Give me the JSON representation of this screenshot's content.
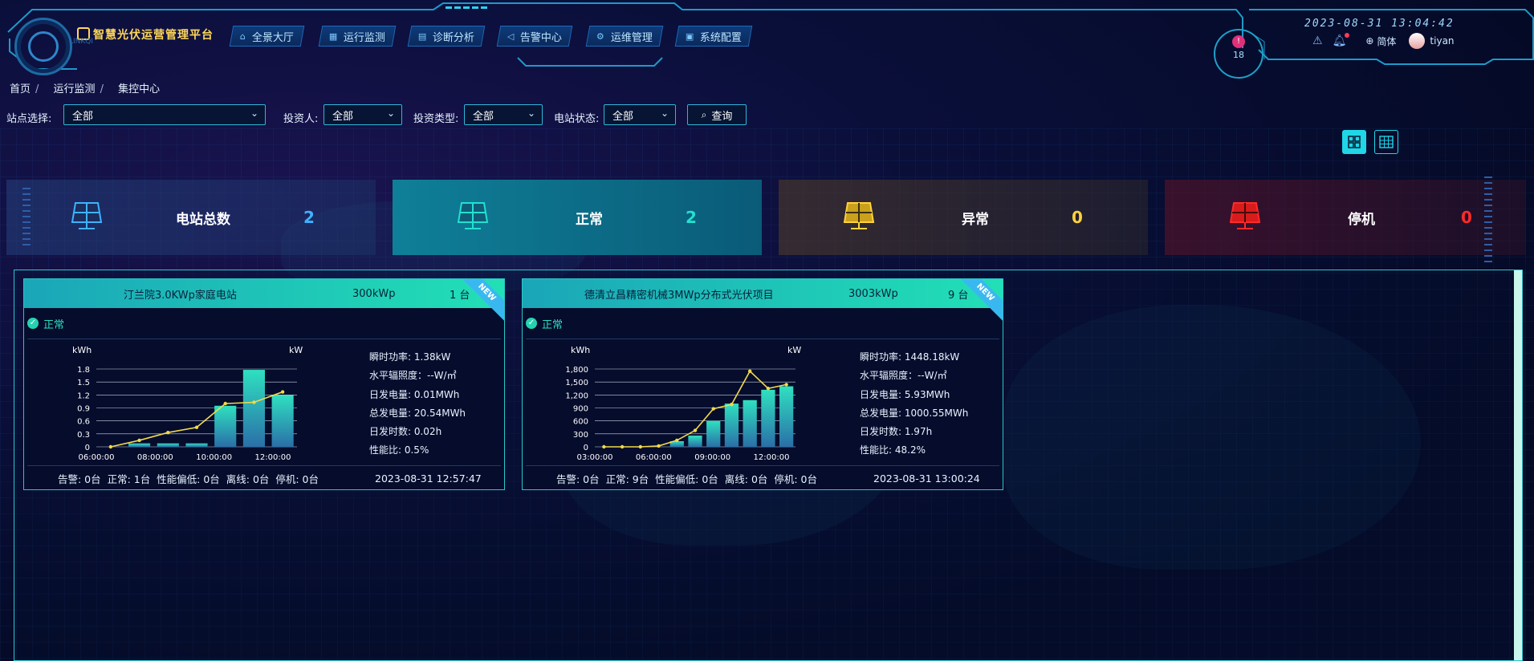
{
  "header": {
    "brand": "智慧光伏运营管理平台",
    "brand_sub": "LINKQI",
    "nav": [
      {
        "label": "全景大厅",
        "icon": "home-icon"
      },
      {
        "label": "运行监测",
        "icon": "grid-icon"
      },
      {
        "label": "诊断分析",
        "icon": "doc-icon"
      },
      {
        "label": "告警中心",
        "icon": "speaker-icon"
      },
      {
        "label": "运维管理",
        "icon": "gear-icon"
      },
      {
        "label": "系统配置",
        "icon": "settings-icon"
      }
    ],
    "clock": "2023-08-31 13:04:42",
    "alarm_count": "18",
    "language": "简体",
    "username": "tiyan"
  },
  "breadcrumb": [
    "首页",
    "运行监测",
    "集控中心"
  ],
  "filters": {
    "station": {
      "label": "站点选择:",
      "value": "全部"
    },
    "investor": {
      "label": "投资人:",
      "value": "全部"
    },
    "invest_type": {
      "label": "投资类型:",
      "value": "全部"
    },
    "station_state": {
      "label": "电站状态:",
      "value": "全部"
    },
    "query_label": "查询"
  },
  "stats": [
    {
      "label": "电站总数",
      "value": "2",
      "color": "#3fb2ff"
    },
    {
      "label": "正常",
      "value": "2",
      "color": "#22e0d0"
    },
    {
      "label": "异常",
      "value": "0",
      "color": "#ffd23a"
    },
    {
      "label": "停机",
      "value": "0",
      "color": "#ff2a2a"
    }
  ],
  "cards": [
    {
      "name": "汀兰院3.0KWp家庭电站",
      "capacity": "300kWp",
      "units": "1 台",
      "ribbon": "NEW",
      "status": "正常",
      "metrics": [
        "瞬时功率: 1.38kW",
        "水平辐照度：--W/㎡",
        "日发电量: 0.01MWh",
        "总发电量: 20.54MWh",
        "日发时数: 0.02h",
        "性能比: 0.5%"
      ],
      "footer": {
        "summary": "告警: 0台  正常: 1台  性能偏低: 0台  离线: 0台  停机: 0台",
        "time": "2023-08-31 12:57:47"
      },
      "chart": {
        "left_unit": "kWh",
        "right_unit": "kW",
        "yticks": [
          "0",
          "0.3",
          "0.6",
          "0.9",
          "1.2",
          "1.5",
          "1.8"
        ],
        "xticks": [
          "06:00:00",
          "08:00:00",
          "10:00:00",
          "12:00:00"
        ]
      }
    },
    {
      "name": "德清立昌精密机械3MWp分布式光伏项目",
      "capacity": "3003kWp",
      "units": "9 台",
      "ribbon": "NEW",
      "status": "正常",
      "metrics": [
        "瞬时功率: 1448.18kW",
        "水平辐照度：--W/㎡",
        "日发电量: 5.93MWh",
        "总发电量: 1000.55MWh",
        "日发时数: 1.97h",
        "性能比: 48.2%"
      ],
      "footer": {
        "summary": "告警: 0台  正常: 9台  性能偏低: 0台  离线: 0台  停机: 0台",
        "time": "2023-08-31 13:00:24"
      },
      "chart": {
        "left_unit": "kWh",
        "right_unit": "kW",
        "yticks": [
          "0",
          "300",
          "600",
          "900",
          "1,200",
          "1,500",
          "1,800"
        ],
        "xticks": [
          "03:00:00",
          "06:00:00",
          "09:00:00",
          "12:00:00"
        ]
      }
    }
  ],
  "chart_data": [
    {
      "type": "bar",
      "ylim": [
        0,
        1.8
      ],
      "yticks": [
        0,
        0.3,
        0.6,
        0.9,
        1.2,
        1.5,
        1.8
      ],
      "xticks": [
        "06:00:00",
        "08:00:00",
        "10:00:00",
        "12:00:00"
      ],
      "series": [
        {
          "values": [
            0,
            0.08,
            0.08,
            0.08,
            0.95,
            1.78,
            1.2
          ]
        },
        {
          "values": [
            0,
            0.15,
            0.33,
            0.45,
            1.0,
            1.03,
            1.27
          ]
        }
      ]
    },
    {
      "type": "bar",
      "ylim": [
        0,
        1800
      ],
      "yticks": [
        0,
        300,
        600,
        900,
        1200,
        1500,
        1800
      ],
      "xticks": [
        "03:00:00",
        "06:00:00",
        "09:00:00",
        "12:00:00"
      ],
      "series": [
        {
          "values": [
            0,
            0,
            0,
            0,
            130,
            260,
            600,
            1000,
            1080,
            1320,
            1400
          ]
        },
        {
          "values": [
            0,
            0,
            0,
            20,
            150,
            380,
            880,
            980,
            1750,
            1350,
            1440
          ]
        }
      ]
    }
  ]
}
